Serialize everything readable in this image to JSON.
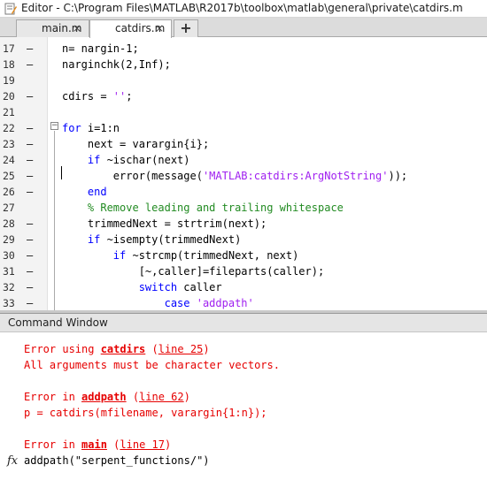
{
  "window": {
    "title": "Editor - C:\\Program Files\\MATLAB\\R2017b\\toolbox\\matlab\\general\\private\\catdirs.m"
  },
  "tabs": [
    {
      "label": "main.m",
      "close": "×"
    },
    {
      "label": "catdirs.m",
      "close": "×"
    }
  ],
  "add_tab_label": "+",
  "editor": {
    "lines": [
      {
        "num": "17",
        "dash": "–",
        "segments": [
          {
            "text": "n= nargin-1;",
            "cls": ""
          }
        ]
      },
      {
        "num": "18",
        "dash": "–",
        "segments": [
          {
            "text": "narginchk(2,Inf);",
            "cls": ""
          }
        ]
      },
      {
        "num": "19",
        "dash": "",
        "segments": []
      },
      {
        "num": "20",
        "dash": "–",
        "segments": [
          {
            "text": "cdirs = ",
            "cls": ""
          },
          {
            "text": "''",
            "cls": "str"
          },
          {
            "text": ";",
            "cls": ""
          }
        ]
      },
      {
        "num": "21",
        "dash": "",
        "segments": []
      },
      {
        "num": "22",
        "dash": "–",
        "segments": [
          {
            "text": "for",
            "cls": "kw"
          },
          {
            "text": " i=1:n",
            "cls": ""
          }
        ]
      },
      {
        "num": "23",
        "dash": "–",
        "segments": [
          {
            "text": "    next = varargin{i};",
            "cls": ""
          }
        ]
      },
      {
        "num": "24",
        "dash": "–",
        "segments": [
          {
            "text": "    ",
            "cls": ""
          },
          {
            "text": "if",
            "cls": "kw"
          },
          {
            "text": " ~ischar(next)",
            "cls": ""
          }
        ]
      },
      {
        "num": "25",
        "dash": "–",
        "segments": [
          {
            "text": "        error(message(",
            "cls": ""
          },
          {
            "text": "'MATLAB:catdirs:ArgNotString'",
            "cls": "str"
          },
          {
            "text": "));",
            "cls": ""
          }
        ]
      },
      {
        "num": "26",
        "dash": "–",
        "segments": [
          {
            "text": "    ",
            "cls": ""
          },
          {
            "text": "end",
            "cls": "kw"
          }
        ]
      },
      {
        "num": "27",
        "dash": "",
        "segments": [
          {
            "text": "    ",
            "cls": ""
          },
          {
            "text": "% Remove leading and trailing whitespace",
            "cls": "cm"
          }
        ]
      },
      {
        "num": "28",
        "dash": "–",
        "segments": [
          {
            "text": "    trimmedNext = strtrim(next);",
            "cls": ""
          }
        ]
      },
      {
        "num": "29",
        "dash": "–",
        "segments": [
          {
            "text": "    ",
            "cls": ""
          },
          {
            "text": "if",
            "cls": "kw"
          },
          {
            "text": " ~isempty(trimmedNext)",
            "cls": ""
          }
        ]
      },
      {
        "num": "30",
        "dash": "–",
        "segments": [
          {
            "text": "        ",
            "cls": ""
          },
          {
            "text": "if",
            "cls": "kw"
          },
          {
            "text": " ~strcmp(trimmedNext, next)",
            "cls": ""
          }
        ]
      },
      {
        "num": "31",
        "dash": "–",
        "segments": [
          {
            "text": "            [~,caller]=fileparts(caller);",
            "cls": ""
          }
        ]
      },
      {
        "num": "32",
        "dash": "–",
        "segments": [
          {
            "text": "            ",
            "cls": ""
          },
          {
            "text": "switch",
            "cls": "kw"
          },
          {
            "text": " caller",
            "cls": ""
          }
        ]
      },
      {
        "num": "33",
        "dash": "–",
        "segments": [
          {
            "text": "                ",
            "cls": ""
          },
          {
            "text": "case",
            "cls": "kw"
          },
          {
            "text": " ",
            "cls": ""
          },
          {
            "text": "'addpath'",
            "cls": "str"
          }
        ]
      }
    ]
  },
  "command_window": {
    "title": "Command Window",
    "error1": {
      "prefix": "Error using ",
      "func": "catdirs",
      "mid": " (",
      "line_link": "line 25",
      "suffix": ")"
    },
    "message": "All arguments must be character vectors.",
    "error2": {
      "prefix": "Error in ",
      "func": "addpath",
      "mid": " (",
      "line_link": "line 62",
      "suffix": ")"
    },
    "code_line": "p = catdirs(mfilename, varargin{1:n});",
    "error3": {
      "prefix": "Error in ",
      "func": "main",
      "mid": " (",
      "line_link": "line 17",
      "suffix": ")"
    },
    "prompt_command": "addpath(\"serpent_functions/\")",
    "fx_symbol": "fx"
  }
}
